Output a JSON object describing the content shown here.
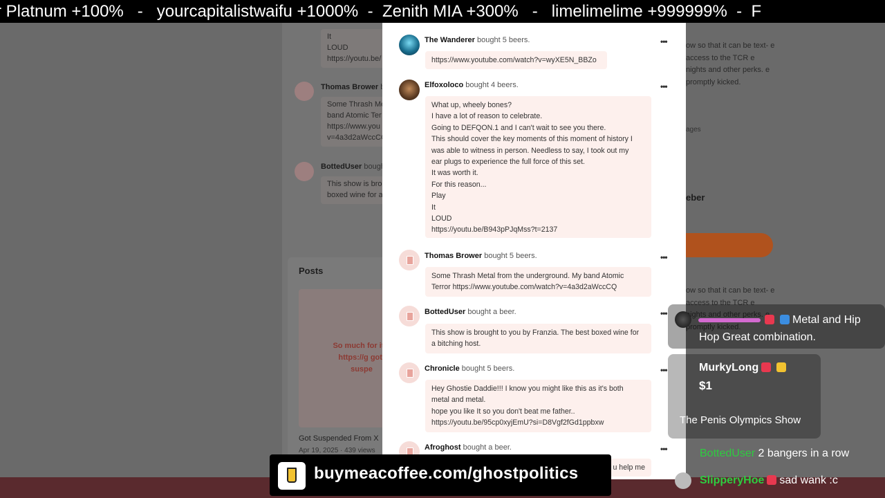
{
  "ticker": {
    "text": "r Platnum +100%   -   yourcapitalistwaifu +1000%  -  Zenith MIA +300%   -   limelimelime +999999%  -  F"
  },
  "background": {
    "left_entries": [
      {
        "lines": [
          "It",
          "LOUD",
          "https://youtu.be/"
        ]
      },
      {
        "name": "Thomas Brower",
        "suffix": "bo",
        "lines": [
          "Some Thrash Me",
          "band Atomic Ter",
          "https://www.you",
          "v=4a3d2aWccCQ"
        ]
      },
      {
        "name": "BottedUser",
        "suffix": "bough",
        "lines": [
          "This show is brou",
          "boxed wine for a"
        ]
      }
    ],
    "posts_title": "Posts",
    "post_preview": "So much for it... https://g got-suspe",
    "post_title": "Got Suspended From X",
    "post_meta": "Apr 19, 2025  ·  439 views",
    "right_text_1": "ow so that it can be text- e access to the TCR e nights and other perks. e promptly kicked.",
    "right_small": "ages",
    "right_name": "eber",
    "right_text_2": "ow so that it can be text- e access to the TCR e nights and other perks. e promptly kicked."
  },
  "modal": {
    "entries": [
      {
        "name": "The Wanderer",
        "action": "bought 5 beers.",
        "lines": [
          "https://www.youtube.com/watch?v=wyXE5N_BBZo"
        ]
      },
      {
        "name": "Elfoxoloco",
        "action": "bought 4 beers.",
        "lines": [
          "What up, wheely bones?",
          "I have a lot of reason to celebrate.",
          "Going to DEFQON.1 and I can't wait to see you there.",
          "This should cover the key moments of this moment of history I",
          "was able to witness in person. Needless to say, I took out my",
          "ear plugs to experience the full force of this set.",
          "It was worth it.",
          "For this reason...",
          "Play",
          "It",
          "LOUD",
          "https://youtu.be/B943pPJqMss?t=2137"
        ]
      },
      {
        "name": "Thomas Brower",
        "action": "bought 5 beers.",
        "lines": [
          "Some Thrash Metal from the underground. My band Atomic",
          "Terror https://www.youtube.com/watch?v=4a3d2aWccCQ"
        ]
      },
      {
        "name": "BottedUser",
        "action": "bought a beer.",
        "lines": [
          "This show is brought to you by Franzia. The best boxed wine for",
          "a bitching host."
        ]
      },
      {
        "name": "Chronicle",
        "action": "bought 5 beers.",
        "lines": [
          "Hey Ghostie Daddie!!! I know you might like this as it's both",
          "metal and metal.",
          "hope you like It so you don't beat me father..",
          "https://youtu.be/95cp0xyjEmU?si=D8Vgf2fGd1ppbxw"
        ]
      },
      {
        "name": "Afroghost",
        "action": "bought a beer.",
        "lines": [
          "u help me"
        ]
      }
    ],
    "more_label": "•••"
  },
  "chat": {
    "msg1": {
      "text_a": "Metal and Hip",
      "text_b": "Hop Great combination."
    },
    "msg2": {
      "user": "MurkyLong",
      "amount": "$1",
      "text": "The Penis Olympics Show"
    },
    "msg3": {
      "user": "BottedUser",
      "text": "2 bangers in a row"
    },
    "msg4": {
      "user": "SlipperyHoe",
      "text": "sad wank :c"
    }
  },
  "banner": {
    "url": "buymeacoffee.com/ghostpolitics"
  },
  "colors": {
    "bubble": "#fdf0ed",
    "accent_orange": "#b0521d",
    "chat_green": "#2ecc40"
  }
}
